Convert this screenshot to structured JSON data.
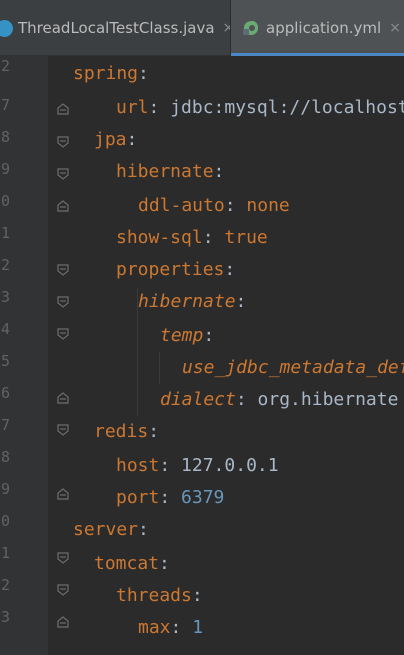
{
  "tabs": [
    {
      "label": "ThreadLocalTestClass.java",
      "close": "×"
    },
    {
      "label": "application.yml",
      "close": "×"
    }
  ],
  "gutter_numbers": [
    "2",
    "7",
    "8",
    "9",
    "0",
    "1",
    "2",
    "3",
    "4",
    "5",
    "6",
    "7",
    "8",
    "9",
    "0",
    "1",
    "2",
    "3"
  ],
  "code": {
    "l0": {
      "key": "spring",
      "colon": ":"
    },
    "l1": {
      "key": "url",
      "colon": ":",
      "value": "jdbc:mysql://localhost"
    },
    "l2": {
      "key": "jpa",
      "colon": ":"
    },
    "l3": {
      "key": "hibernate",
      "colon": ":"
    },
    "l4": {
      "key": "ddl-auto",
      "colon": ":",
      "value": "none"
    },
    "l5": {
      "key": "show-sql",
      "colon": ":",
      "value": "true"
    },
    "l6": {
      "key": "properties",
      "colon": ":"
    },
    "l7": {
      "key": "hibernate",
      "colon": ":"
    },
    "l8": {
      "key": "temp",
      "colon": ":"
    },
    "l9": {
      "key": "use_jdbc_metadata_defaults"
    },
    "l10": {
      "key": "dialect",
      "colon": ":",
      "value": "org.hibernate"
    },
    "l11": {
      "key": "redis",
      "colon": ":"
    },
    "l12": {
      "key": "host",
      "colon": ":",
      "value": "127.0.0.1"
    },
    "l13": {
      "key": "port",
      "colon": ":",
      "value": "6379"
    },
    "l14": {
      "key": "server",
      "colon": ":"
    },
    "l15": {
      "key": "tomcat",
      "colon": ":"
    },
    "l16": {
      "key": "threads",
      "colon": ":"
    },
    "l17": {
      "key": "max",
      "colon": ":",
      "value": "1"
    }
  },
  "colors": {
    "key": "#cc7832",
    "text": "#a9b7c6",
    "number": "#6897bb",
    "background": "#2b2b2b"
  }
}
